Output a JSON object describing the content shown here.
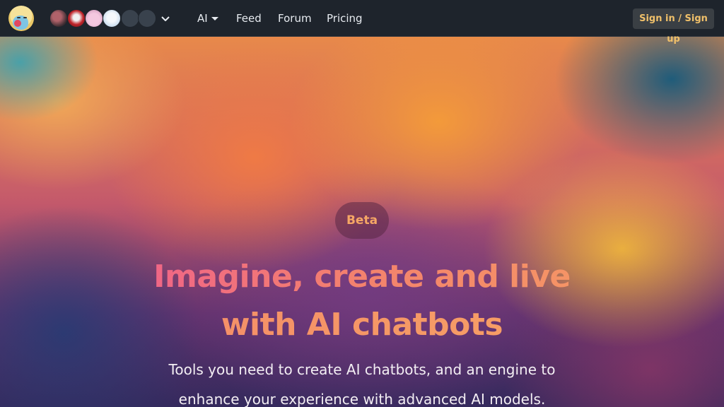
{
  "header": {
    "avatars": [
      {
        "name": "avatar-1",
        "color": "#6b3a3a"
      },
      {
        "name": "avatar-2",
        "color": "#c0242a"
      },
      {
        "name": "avatar-3",
        "color": "#e8b6d6"
      },
      {
        "name": "avatar-4",
        "color": "#cfe0ef"
      },
      {
        "name": "avatar-5",
        "color": "#39424d"
      },
      {
        "name": "avatar-6",
        "color": "#39424d"
      }
    ],
    "nav": {
      "ai_label": "AI",
      "feed_label": "Feed",
      "forum_label": "Forum",
      "pricing_label": "Pricing"
    },
    "signin_label": "Sign in / Sign up"
  },
  "hero": {
    "badge": "Beta",
    "headline_line1": "Imagine, create and live",
    "headline_line2": "with AI chatbots",
    "subtext_line1": "Tools you need to create AI chatbots, and an engine to",
    "subtext_line2": "enhance your experience with advanced AI models."
  },
  "colors": {
    "header_bg": "#1e242c",
    "signin_text": "#f0c06a",
    "badge_text": "#f6a765",
    "headline_pink": "#ef5d8e",
    "headline_orange": "#f6a364"
  }
}
